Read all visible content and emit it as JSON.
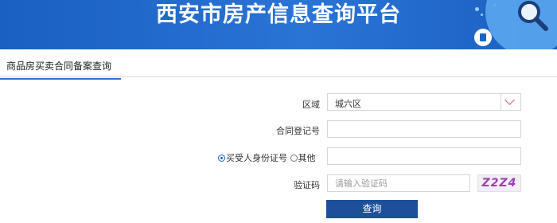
{
  "banner": {
    "title": "西安市房产信息查询平台"
  },
  "tabs": [
    {
      "label": "商品房买卖合同备案查询"
    }
  ],
  "form": {
    "district_label": "区域",
    "district_value": "城六区",
    "contract_no_label": "合同登记号",
    "id_type_selected_label": "买受人身份证号",
    "id_type_other_label": "其他",
    "captcha_label": "验证码",
    "captcha_placeholder": "请输入验证码",
    "captcha_text": "Z2Z4",
    "submit_label": "查询"
  },
  "colors": {
    "banner": "#1e63c4",
    "button": "#1e4f9a",
    "tab_underline": "#2a6dd1"
  }
}
